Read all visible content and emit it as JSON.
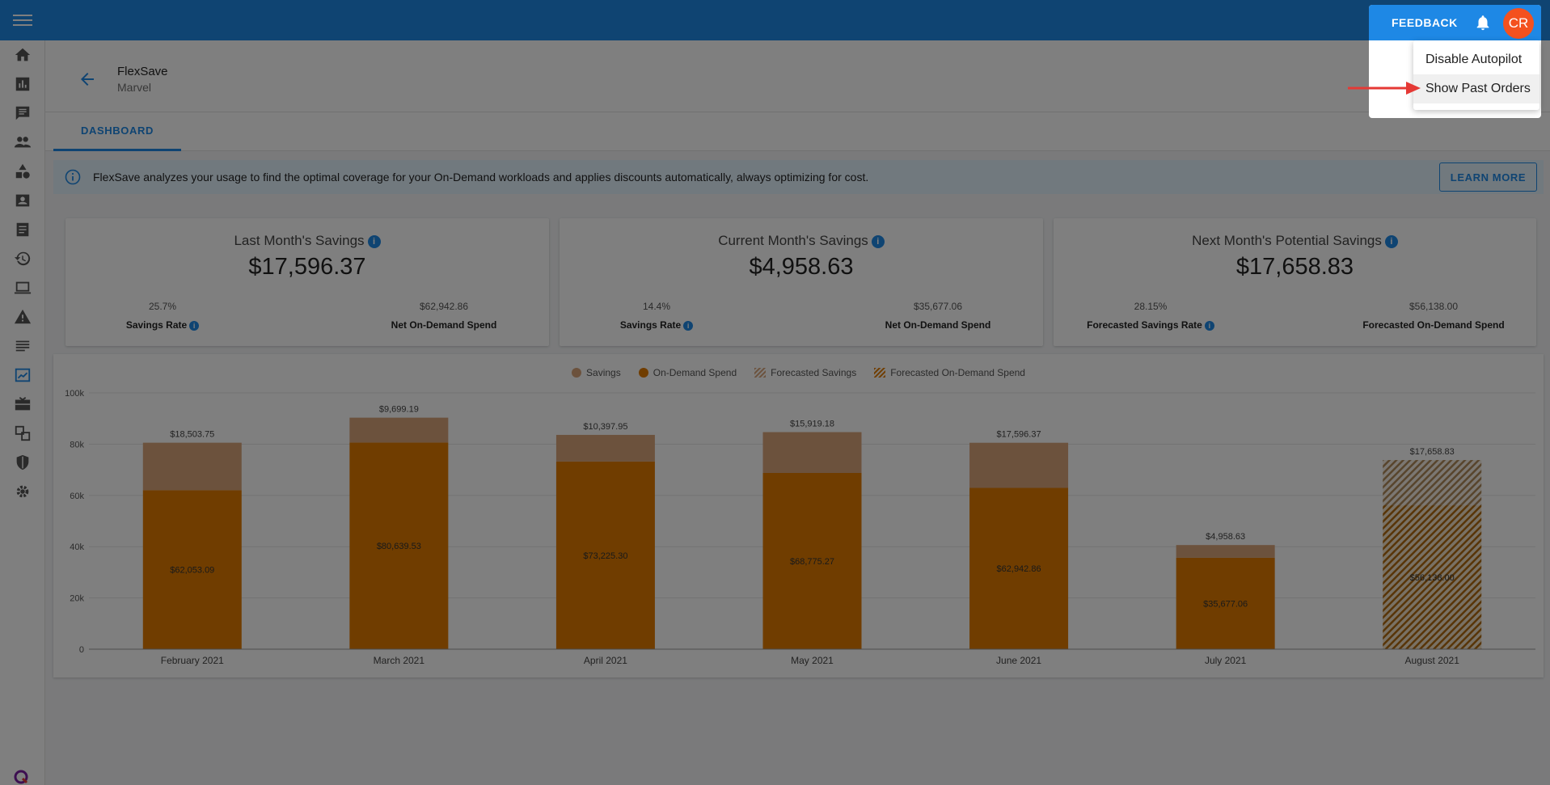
{
  "header": {
    "feedback_label": "FEEDBACK",
    "avatar_initials": "CR"
  },
  "account_menu": {
    "items": [
      {
        "label": "Disable Autopilot"
      },
      {
        "label": "Show Past Orders"
      }
    ]
  },
  "page": {
    "title": "FlexSave",
    "subtitle": "Marvel",
    "tabs": [
      {
        "label": "DASHBOARD"
      }
    ]
  },
  "banner": {
    "text": "FlexSave analyzes your usage to find the optimal coverage for your On-Demand workloads and applies discounts automatically, always optimizing for cost.",
    "button_label": "LEARN MORE"
  },
  "cards": [
    {
      "title": "Last Month's Savings",
      "value": "$17,596.37",
      "left_value": "25.7%",
      "left_label": "Savings Rate",
      "right_value": "$62,942.86",
      "right_label": "Net On-Demand Spend"
    },
    {
      "title": "Current Month's Savings",
      "value": "$4,958.63",
      "left_value": "14.4%",
      "left_label": "Savings Rate",
      "right_value": "$35,677.06",
      "right_label": "Net On-Demand Spend"
    },
    {
      "title": "Next Month's Potential Savings",
      "value": "$17,658.83",
      "left_value": "28.15%",
      "left_label": "Forecasted Savings Rate",
      "right_value": "$56,138.00",
      "right_label": "Forecasted On-Demand Spend"
    }
  ],
  "colors": {
    "primary": "#1e88e5",
    "savings": "#d9a57a",
    "on_demand": "#e07b00"
  },
  "chart_data": {
    "type": "bar",
    "stacked": true,
    "legend_position": "top-center",
    "legend": [
      "Savings",
      "On-Demand Spend",
      "Forecasted Savings",
      "Forecasted On-Demand Spend"
    ],
    "categories": [
      "February 2021",
      "March 2021",
      "April 2021",
      "May 2021",
      "June 2021",
      "July 2021",
      "August 2021"
    ],
    "series": [
      {
        "name": "On-Demand Spend",
        "values": [
          62053.09,
          80639.53,
          73225.3,
          68775.27,
          62942.86,
          35677.06,
          null
        ],
        "labels": [
          "$62,053.09",
          "$80,639.53",
          "$73,225.30",
          "$68,775.27",
          "$62,942.86",
          "$35,677.06",
          null
        ]
      },
      {
        "name": "Savings",
        "values": [
          18503.75,
          9699.19,
          10397.95,
          15919.18,
          17596.37,
          4958.63,
          null
        ],
        "labels": [
          "$18,503.75",
          "$9,699.19",
          "$10,397.95",
          "$15,919.18",
          "$17,596.37",
          "$4,958.63",
          null
        ]
      },
      {
        "name": "Forecasted On-Demand Spend",
        "values": [
          null,
          null,
          null,
          null,
          null,
          null,
          56138.0
        ],
        "labels": [
          null,
          null,
          null,
          null,
          null,
          null,
          "$56,138.00"
        ]
      },
      {
        "name": "Forecasted Savings",
        "values": [
          null,
          null,
          null,
          null,
          null,
          null,
          17658.83
        ],
        "labels": [
          null,
          null,
          null,
          null,
          null,
          null,
          "$17,658.83"
        ]
      }
    ],
    "yticks": [
      "0",
      "20k",
      "40k",
      "60k",
      "80k",
      "100k"
    ],
    "ylim": [
      0,
      100000
    ],
    "grid": true
  }
}
